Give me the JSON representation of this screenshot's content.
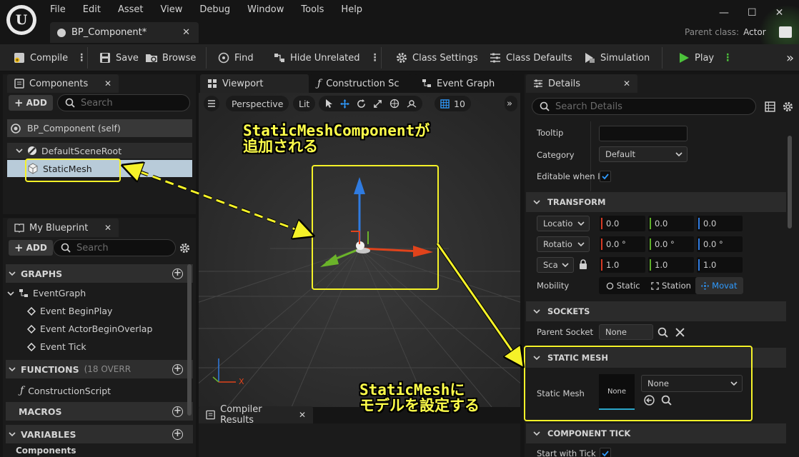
{
  "menu": [
    "File",
    "Edit",
    "Asset",
    "View",
    "Debug",
    "Window",
    "Tools",
    "Help"
  ],
  "document_tab": {
    "title": "BP_Component*",
    "close": "✕"
  },
  "parent_class": {
    "label": "Parent class:",
    "value": "Actor"
  },
  "window_buttons": {
    "minimize": "—",
    "maximize": "☐",
    "close": "✕"
  },
  "toolbar": {
    "compile": "Compile",
    "save": "Save",
    "browse": "Browse",
    "find": "Find",
    "hide_unrelated": "Hide Unrelated",
    "class_settings": "Class Settings",
    "class_defaults": "Class Defaults",
    "simulation": "Simulation",
    "play": "Play",
    "kebab": "⋮",
    "overflow": "»"
  },
  "components_panel": {
    "tab": "Components",
    "add": "ADD",
    "search_placeholder": "Search",
    "items": [
      "BP_Component (self)",
      "DefaultSceneRoot",
      "StaticMesh"
    ]
  },
  "blueprint_panel": {
    "tab": "My Blueprint",
    "add": "ADD",
    "search_placeholder": "Search",
    "graphs": {
      "label": "GRAPHS",
      "event_graph": "EventGraph",
      "events": [
        "Event BeginPlay",
        "Event ActorBeginOverlap",
        "Event Tick"
      ]
    },
    "functions": {
      "label": "FUNCTIONS",
      "sub": "(18 OVERR",
      "items": [
        "ConstructionScript"
      ]
    },
    "macros": "MACROS",
    "variables": "VARIABLES",
    "components": "Components"
  },
  "viewport": {
    "tabs": [
      "Viewport",
      "Construction Sc",
      "Event Graph"
    ],
    "perspective": "Perspective",
    "lit": "Lit",
    "grid_value": "10",
    "axis_x": "X"
  },
  "compiler": {
    "tab": "Compiler Results"
  },
  "details": {
    "tab": "Details",
    "search_placeholder": "Search Details",
    "tooltip": "Tooltip",
    "category": "Category",
    "category_value": "Default",
    "editable": "Editable when I",
    "transform": "TRANSFORM",
    "location": "Locatio",
    "rotation": "Rotatio",
    "scale": "Sca",
    "location_values": [
      "0.0",
      "0.0",
      "0.0"
    ],
    "rotation_values": [
      "0.0 °",
      "0.0 °",
      "0.0 °"
    ],
    "scale_values": [
      "1.0",
      "1.0",
      "1.0"
    ],
    "mobility": "Mobility",
    "mobility_options": [
      "Static",
      "Station",
      "Movat"
    ],
    "sockets": "SOCKETS",
    "parent_socket": "Parent Socket",
    "parent_socket_value": "None",
    "static_mesh_section": "STATIC MESH",
    "static_mesh_label": "Static Mesh",
    "static_mesh_thumb": "None",
    "static_mesh_value": "None",
    "component_tick": "COMPONENT TICK",
    "start_with_tick": "Start with Tick"
  },
  "annotations": {
    "top": [
      "StaticMeshComponentが",
      "追加される"
    ],
    "bottom": [
      "StaticMeshに",
      "モデルを設定する"
    ],
    "color": "#f5f228"
  },
  "colors": {
    "accent_blue": "#2f9bff",
    "selection": "#b8cbd9",
    "play_green": "#4cc23b"
  }
}
